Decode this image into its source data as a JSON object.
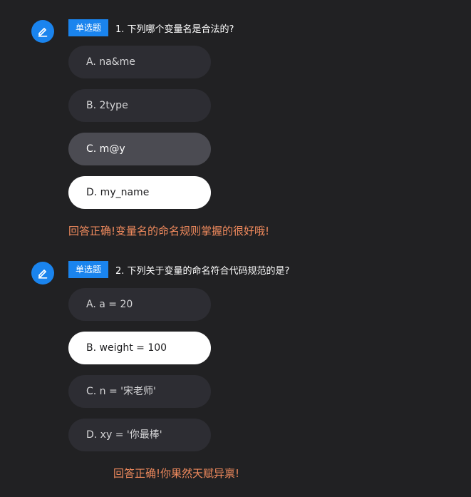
{
  "colors": {
    "background": "#212123",
    "accent": "#1a84ee",
    "option_bg": "#2d2d33",
    "option_hover_bg": "#4b4b52",
    "option_selected_bg": "#ffffff",
    "feedback_text": "#f08a5d"
  },
  "questions": [
    {
      "icon": "edit-icon",
      "tag": "单选题",
      "text": "1. 下列哪个变量名是合法的?",
      "options": [
        {
          "label": "A. na&me",
          "state": "default"
        },
        {
          "label": "B. 2type",
          "state": "default"
        },
        {
          "label": "C. m@y",
          "state": "hover"
        },
        {
          "label": "D. my_name",
          "state": "selected"
        }
      ],
      "feedback": "回答正确!变量名的命名规则掌握的很好哦!"
    },
    {
      "icon": "edit-icon",
      "tag": "单选题",
      "text": "2. 下列关于变量的命名符合代码规范的是?",
      "options": [
        {
          "label": "A. a = 20",
          "state": "default"
        },
        {
          "label": "B. weight = 100",
          "state": "selected"
        },
        {
          "label": "C. n = '宋老师'",
          "state": "default"
        },
        {
          "label": "D. xy = '你最棒'",
          "state": "default"
        }
      ],
      "feedback": "回答正确!你果然天赋异禀!"
    }
  ]
}
